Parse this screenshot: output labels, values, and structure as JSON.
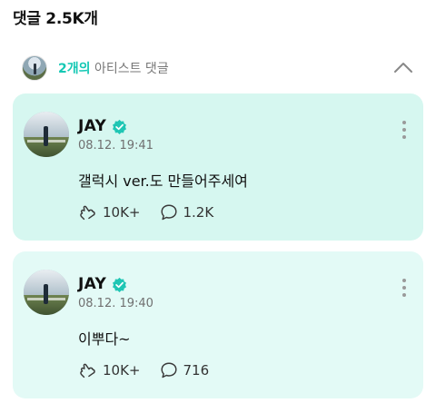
{
  "header": {
    "title": "댓글 2.5K개"
  },
  "artist_section": {
    "count": "2개의",
    "label": " 아티스트 댓글",
    "collapse_icon": "chevron-up-icon"
  },
  "comments": [
    {
      "author": "JAY",
      "verified_icon": "verified-check-icon",
      "timestamp": "08.12. 19:41",
      "text": "갤럭시 ver.도 만들어주세여",
      "likes": "10K+",
      "replies": "1.2K",
      "like_icon": "heart-hand-icon",
      "reply_icon": "speech-bubble-icon",
      "more_icon": "more-vertical-icon"
    },
    {
      "author": "JAY",
      "verified_icon": "verified-check-icon",
      "timestamp": "08.12. 19:40",
      "text": "이뿌다~",
      "likes": "10K+",
      "replies": "716",
      "like_icon": "heart-hand-icon",
      "reply_icon": "speech-bubble-icon",
      "more_icon": "more-vertical-icon"
    }
  ],
  "colors": {
    "accent": "#14c8b4",
    "card_1_bg": "#d6f7f0",
    "card_2_bg": "#e3faf6",
    "verified": "#1fc6b4"
  }
}
